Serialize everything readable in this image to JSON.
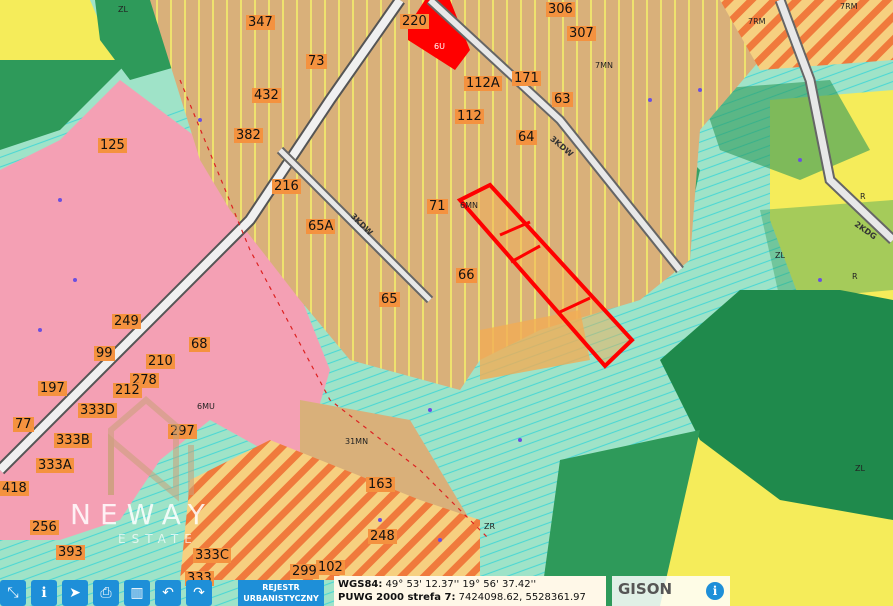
{
  "map": {
    "parcel_labels": [
      "347",
      "220",
      "306",
      "307",
      "73",
      "171",
      "112A",
      "432",
      "63",
      "112",
      "382",
      "64",
      "216",
      "71",
      "65A",
      "66",
      "65",
      "249",
      "68",
      "99",
      "210",
      "278",
      "212",
      "197",
      "333D",
      "77",
      "297",
      "333B",
      "333A",
      "418",
      "163",
      "256",
      "248",
      "393",
      "333C",
      "299",
      "102",
      "333",
      "125"
    ],
    "zone_labels": [
      "ZL",
      "6U",
      "7MN",
      "6MN",
      "6MU",
      "31MN",
      "ZR",
      "7RM",
      "7RM",
      "ZL",
      "R",
      "ZL",
      "R"
    ],
    "road_labels": [
      "3KDW",
      "3KDW",
      "2KDG"
    ],
    "colors": {
      "meadow": "#9fe3c8",
      "building_zone": "#d9b07a",
      "residential_pink": "#f4a0b4",
      "forest": "#2e9a5a",
      "agricultural_yellow": "#f5ec5a",
      "highlight_red": "#ff0000",
      "label_orange": "#f4923f",
      "toolbar_blue": "#1e8fd8"
    }
  },
  "toolbar": {
    "buttons": [
      {
        "icon": "measure-icon",
        "glyph": "⤡"
      },
      {
        "icon": "info-person-icon",
        "glyph": "ℹ"
      },
      {
        "icon": "navigate-icon",
        "glyph": "➤"
      },
      {
        "icon": "print-icon",
        "glyph": "⎙"
      },
      {
        "icon": "book-icon",
        "glyph": "▥"
      },
      {
        "icon": "undo-icon",
        "glyph": "↶"
      },
      {
        "icon": "redo-icon",
        "glyph": "↷"
      }
    ],
    "rejestr_line1": "REJESTR",
    "rejestr_line2": "URBANISTYCZNY"
  },
  "coordinates": {
    "wgs_label": "WGS84:",
    "wgs_value": "49° 53' 12.37'' 19° 56' 37.42''",
    "puwg_label": "PUWG 2000 strefa 7:",
    "puwg_value": "7424098.62, 5528361.97"
  },
  "gison": {
    "name": "GISON"
  },
  "watermark": {
    "brand": "NEWAY",
    "sub": "ESTATE"
  }
}
